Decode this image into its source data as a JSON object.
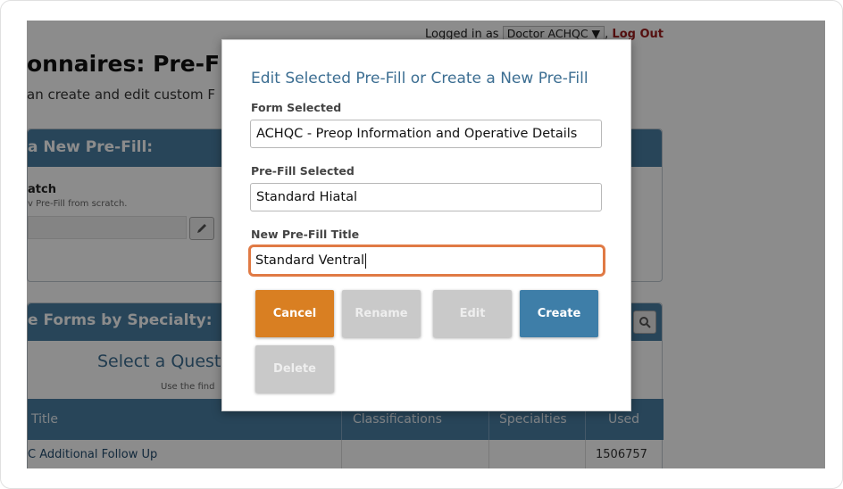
{
  "header": {
    "logged_in_label": "Logged in as",
    "user": "Doctor ACHQC ▼",
    "separator": ",",
    "logout": "Log Out"
  },
  "page": {
    "title": "onnaires: Pre-Fil",
    "subtitle": "an create and edit custom F"
  },
  "new_prefill_panel": {
    "header": "a New Pre-Fill:",
    "scratch_title": "atch",
    "scratch_sub": "v Pre-Fill from scratch."
  },
  "forms_panel": {
    "header": "e Forms by Specialty:",
    "select_heading": "Select a Questi",
    "use_find": "Use the find",
    "columns": [
      "Title",
      "Classifications",
      "Specialties",
      "Used"
    ],
    "rows": [
      {
        "title": "C Additional Follow Up",
        "classifications": "",
        "specialties": "",
        "used": "1506757"
      }
    ]
  },
  "modal": {
    "title": "Edit Selected Pre-Fill or Create a New Pre-Fill",
    "form_selected_label": "Form Selected",
    "form_selected_value": "ACHQC - Preop Information and Operative Details",
    "prefill_selected_label": "Pre-Fill Selected",
    "prefill_selected_value": "Standard Hiatal",
    "new_title_label": "New Pre-Fill Title",
    "new_title_value": "Standard Ventral",
    "buttons": {
      "cancel": "Cancel",
      "rename": "Rename",
      "edit": "Edit",
      "create": "Create",
      "delete": "Delete"
    }
  },
  "colors": {
    "header_blue": "#4a7ea3",
    "accent_orange": "#d97f22",
    "focus_ring": "#e07a45",
    "create_blue": "#3e7ea8",
    "logout_red": "#9b1c1c"
  }
}
